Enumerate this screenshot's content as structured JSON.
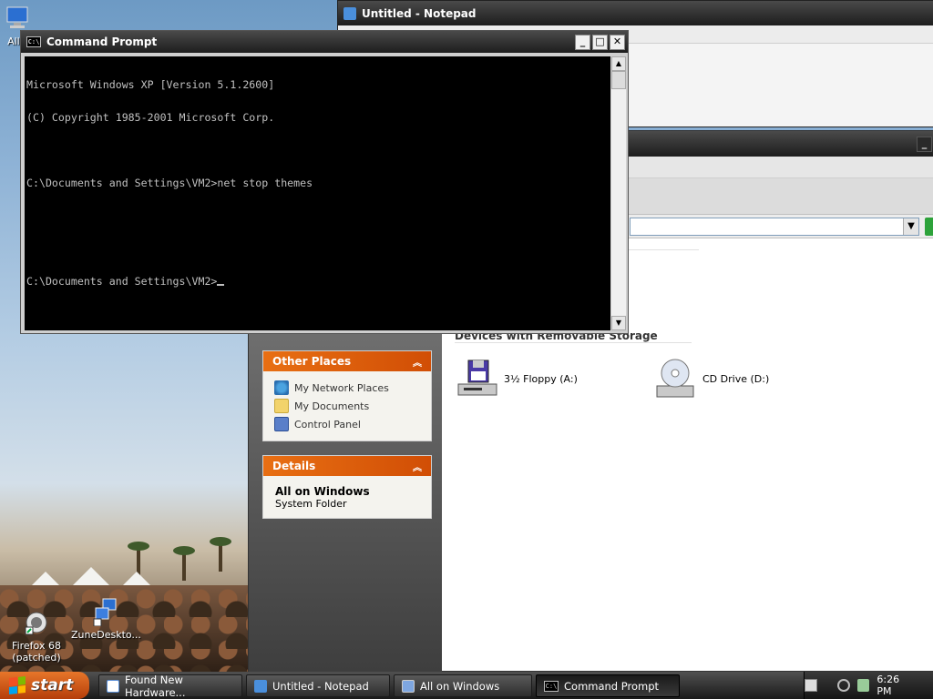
{
  "desktop": {
    "icons": [
      {
        "label": "All o",
        "icon": "computer-icon"
      },
      {
        "label": "Firefox 68 (patched)",
        "icon": "firefox-shortcut-icon"
      },
      {
        "label": "ZuneDeskto...",
        "icon": "network-shortcut-icon"
      }
    ]
  },
  "notepad": {
    "title": "Untitled - Notepad"
  },
  "explorer": {
    "other_places": {
      "title": "Other Places",
      "items": [
        "My Network Places",
        "My Documents",
        "Control Panel"
      ]
    },
    "details": {
      "title": "Details",
      "name": "All on Windows",
      "type": "System Folder"
    },
    "group_title": "Devices with Removable Storage",
    "drives": [
      {
        "label": "3½ Floppy (A:)",
        "icon": "floppy-drive-icon"
      },
      {
        "label": "CD Drive (D:)",
        "icon": "cd-drive-icon"
      }
    ]
  },
  "cmd": {
    "title": "Command Prompt",
    "lines": [
      "Microsoft Windows XP [Version 5.1.2600]",
      "(C) Copyright 1985-2001 Microsoft Corp.",
      "",
      "C:\\Documents and Settings\\VM2>net stop themes",
      "",
      "",
      "C:\\Documents and Settings\\VM2>"
    ]
  },
  "taskbar": {
    "start_label": "start",
    "tasks": [
      {
        "label": "Found New Hardware...",
        "active": false
      },
      {
        "label": "Untitled - Notepad",
        "active": false
      },
      {
        "label": "All on Windows",
        "active": false
      },
      {
        "label": "Command Prompt",
        "active": true
      }
    ],
    "clock": "6:26 PM"
  }
}
